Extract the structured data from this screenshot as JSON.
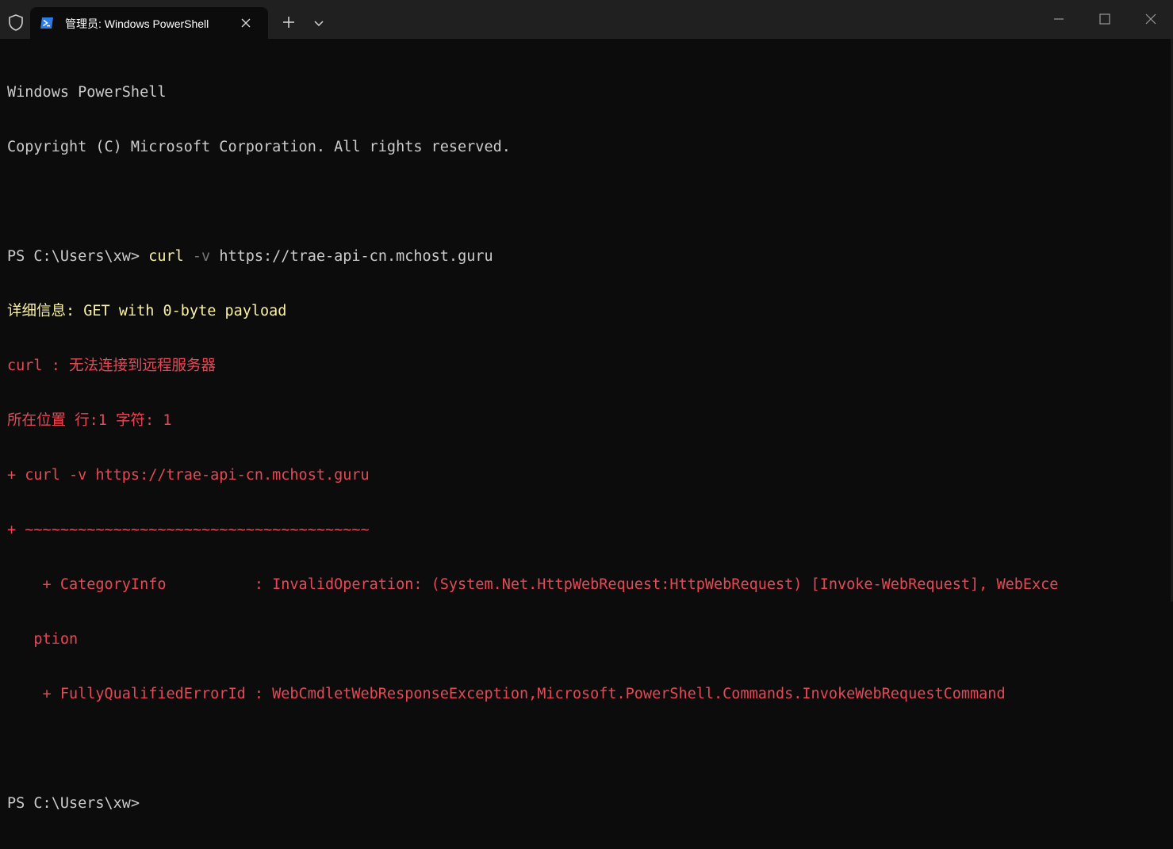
{
  "window": {
    "tab_title": "管理员: Windows PowerShell"
  },
  "terminal": {
    "line1": "Windows PowerShell",
    "line2": "Copyright (C) Microsoft Corporation. All rights reserved.",
    "prompt1": "PS C:\\Users\\xw> ",
    "cmd_curl": "curl",
    "cmd_flag": " -v",
    "cmd_url": " https://trae-api-cn.mchost.guru",
    "verbose": "详细信息: GET with 0-byte payload",
    "error1": "curl : 无法连接到远程服务器",
    "error2": "所在位置 行:1 字符: 1",
    "error3": "+ curl -v https://trae-api-cn.mchost.guru",
    "error4": "+ ~~~~~~~~~~~~~~~~~~~~~~~~~~~~~~~~~~~~~~~",
    "error5": "    + CategoryInfo          : InvalidOperation: (System.Net.HttpWebRequest:HttpWebRequest) [Invoke-WebRequest], WebExce",
    "error6": "   ption",
    "error7": "    + FullyQualifiedErrorId : WebCmdletWebResponseException,Microsoft.PowerShell.Commands.InvokeWebRequestCommand",
    "prompt2": "PS C:\\Users\\xw>"
  },
  "icons": {
    "shield": "shield-icon",
    "powershell": "powershell-icon",
    "close_tab": "close-icon",
    "new_tab": "plus-icon",
    "dropdown": "chevron-down-icon",
    "minimize": "minimize-icon",
    "maximize": "maximize-icon",
    "close_window": "close-icon"
  },
  "colors": {
    "background": "#0c0c0c",
    "titlebar": "#202020",
    "text": "#cccccc",
    "yellow": "#f9f1a5",
    "red": "#e74856"
  }
}
